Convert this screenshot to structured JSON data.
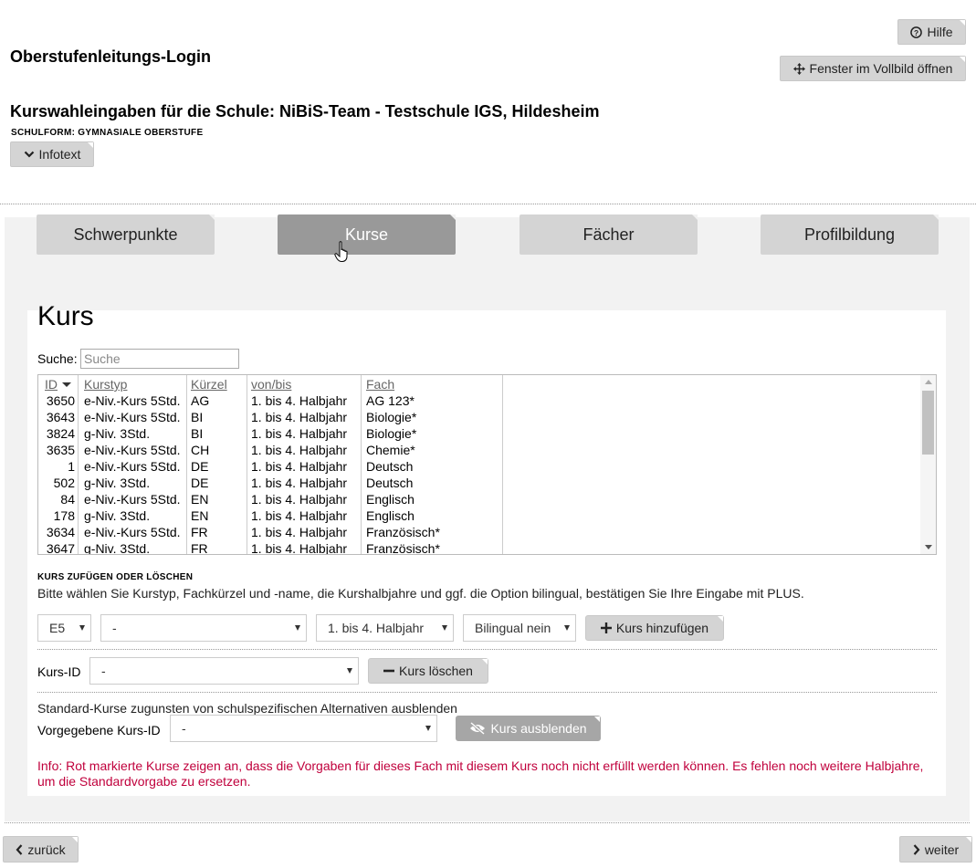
{
  "header": {
    "help_label": "Hilfe",
    "fullscreen_label": "Fenster im Vollbild öffnen",
    "page_title": "Oberstufenleitungs-Login",
    "school_title": "Kurswahleingaben für die Schule: NiBiS-Team - Testschule IGS, Hildesheim",
    "schulform": "SCHULFORM: GYMNASIALE OBERSTUFE",
    "infotext_label": "Infotext"
  },
  "tabs": [
    {
      "label": "Schwerpunkte",
      "active": false
    },
    {
      "label": "Kurse",
      "active": true
    },
    {
      "label": "Fächer",
      "active": false
    },
    {
      "label": "Profilbildung",
      "active": false
    }
  ],
  "panel": {
    "title": "Kurs",
    "search_label": "Suche:",
    "search_placeholder": "Suche",
    "table": {
      "columns": [
        "ID",
        "Kurstyp",
        "Kürzel",
        "von/bis",
        "Fach"
      ],
      "rows": [
        [
          "3650",
          "e-Niv.-Kurs 5Std.",
          "AG",
          "1. bis 4. Halbjahr",
          "AG 123*"
        ],
        [
          "3643",
          "e-Niv.-Kurs 5Std.",
          "BI",
          "1. bis 4. Halbjahr",
          "Biologie*"
        ],
        [
          "3824",
          "g-Niv. 3Std.",
          "BI",
          "1. bis 4. Halbjahr",
          "Biologie*"
        ],
        [
          "3635",
          "e-Niv.-Kurs 5Std.",
          "CH",
          "1. bis 4. Halbjahr",
          "Chemie*"
        ],
        [
          "1",
          "e-Niv.-Kurs 5Std.",
          "DE",
          "1. bis 4. Halbjahr",
          "Deutsch"
        ],
        [
          "502",
          "g-Niv. 3Std.",
          "DE",
          "1. bis 4. Halbjahr",
          "Deutsch"
        ],
        [
          "84",
          "e-Niv.-Kurs 5Std.",
          "EN",
          "1. bis 4. Halbjahr",
          "Englisch"
        ],
        [
          "178",
          "g-Niv. 3Std.",
          "EN",
          "1. bis 4. Halbjahr",
          "Englisch"
        ],
        [
          "3634",
          "e-Niv.-Kurs 5Std.",
          "FR",
          "1. bis 4. Halbjahr",
          "Französisch*"
        ],
        [
          "3647",
          "g-Niv. 3Std.",
          "FR",
          "1. bis 4. Halbjahr",
          "Französisch*"
        ]
      ]
    },
    "add_section": {
      "heading": "KURS ZUFÜGEN ODER LÖSCHEN",
      "description": "Bitte wählen Sie Kurstyp, Fachkürzel und -name, die Kurshalbjahre und ggf. die Option bilingual, bestätigen Sie Ihre Eingabe mit PLUS.",
      "kurstyp_value": "E5",
      "fach_value": "-",
      "halbjahr_value": "1. bis 4. Halbjahr",
      "bilingual_value": "Bilingual nein",
      "add_label": "Kurs hinzufügen"
    },
    "delete_section": {
      "kursid_label": "Kurs-ID",
      "kursid_value": "-",
      "delete_label": "Kurs löschen"
    },
    "hide_section": {
      "description": "Standard-Kurse zugunsten von schulspezifischen Alternativen ausblenden",
      "label": "Vorgegebene Kurs-ID",
      "value": "-",
      "hide_label": "Kurs ausblenden"
    },
    "info": "Info: Rot markierte Kurse zeigen an, dass die Vorgaben für dieses Fach mit diesem Kurs noch nicht erfüllt werden können. Es fehlen noch weitere Halbjahre, um die Standardvorgabe zu ersetzen."
  },
  "footer": {
    "back_label": "zurück",
    "next_label": "weiter"
  },
  "colors": {
    "tab_active": "#999999",
    "tab_inactive": "#d4d4d4",
    "info_red": "#c0003c"
  }
}
